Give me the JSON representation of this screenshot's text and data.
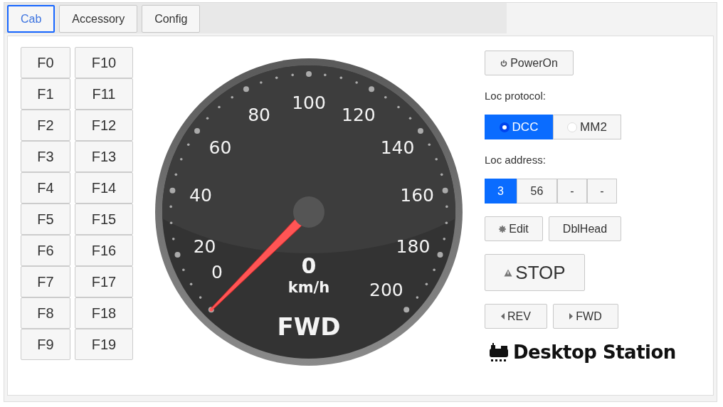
{
  "tabs": [
    {
      "label": "Cab",
      "selected": true
    },
    {
      "label": "Accessory",
      "selected": false
    },
    {
      "label": "Config",
      "selected": false
    }
  ],
  "function_buttons": [
    "F0",
    "F1",
    "F2",
    "F3",
    "F4",
    "F5",
    "F6",
    "F7",
    "F8",
    "F9",
    "F10",
    "F11",
    "F12",
    "F13",
    "F14",
    "F15",
    "F16",
    "F17",
    "F18",
    "F19"
  ],
  "gauge": {
    "scale_labels": [
      "100",
      "80",
      "120",
      "60",
      "140",
      "40",
      "160",
      "20",
      "180",
      "0",
      "200"
    ],
    "value": "0",
    "unit": "km/h",
    "direction": "FWD",
    "level": 0
  },
  "power_button": "PowerOn",
  "protocol": {
    "label": "Loc protocol:",
    "options": [
      {
        "label": "DCC",
        "selected": true
      },
      {
        "label": "MM2",
        "selected": false
      }
    ]
  },
  "address": {
    "label": "Loc address:",
    "slots": [
      {
        "label": "3",
        "selected": true
      },
      {
        "label": "56",
        "selected": false
      },
      {
        "label": "-",
        "selected": false
      },
      {
        "label": "-",
        "selected": false
      }
    ]
  },
  "edit_button": "Edit",
  "dblhead_button": "DblHead",
  "stop_button": "STOP",
  "direction_buttons": [
    {
      "kind": "rev",
      "label": "REV"
    },
    {
      "kind": "fwd",
      "label": "FWD"
    }
  ],
  "logo": "Desktop Station"
}
